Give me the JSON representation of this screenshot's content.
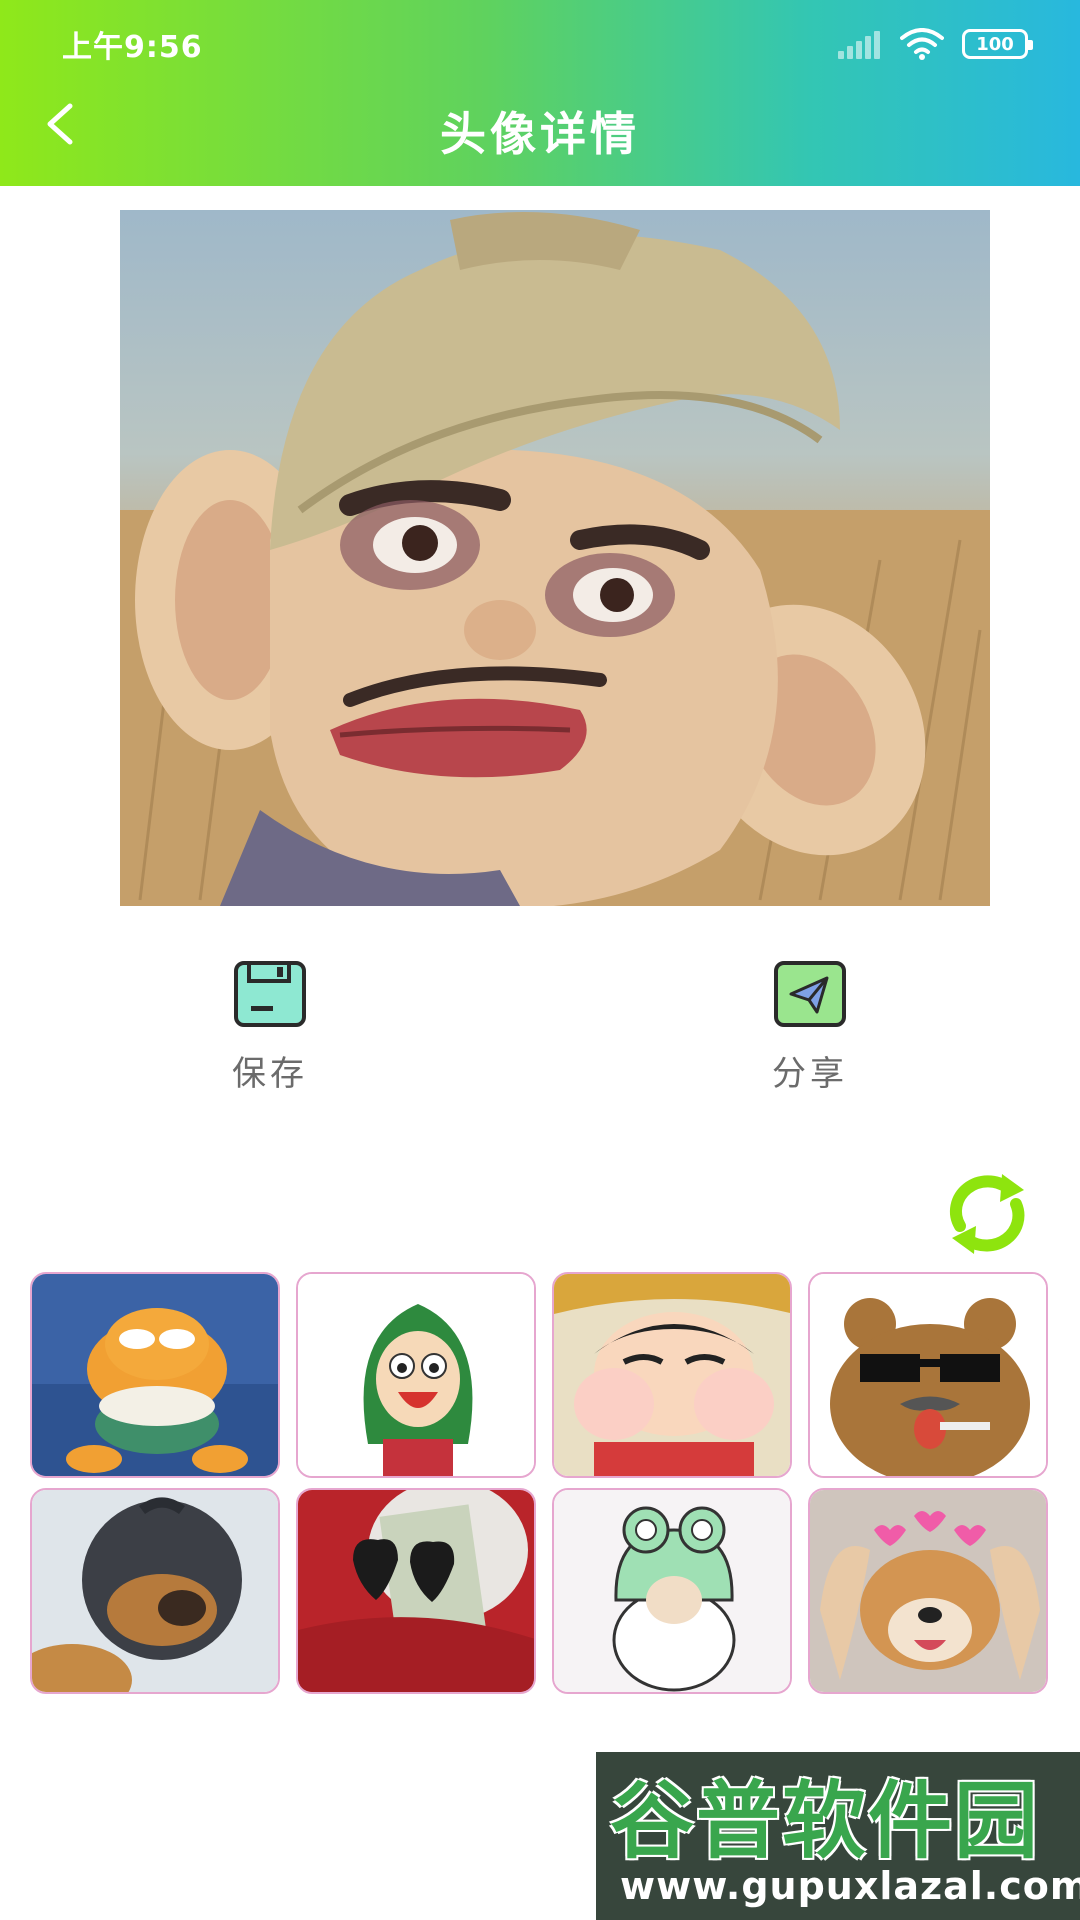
{
  "status_bar": {
    "time": "上午9:56",
    "battery": "100"
  },
  "header": {
    "title": "头像详情",
    "gradient_colors": [
      "#8fe81a",
      "#28b8de"
    ]
  },
  "actions": {
    "save_label": "保存",
    "share_label": "分享"
  },
  "colors": {
    "thumb_border": "#e6a6cf",
    "refresh_icon": "#8ee40e",
    "label_text": "#6b6b6b"
  },
  "thumbnails": [
    {
      "subject": "garfield-popcorn"
    },
    {
      "subject": "cartoon-girl-headscarf"
    },
    {
      "subject": "crayon-shin-chan"
    },
    {
      "subject": "bear-sunglasses"
    },
    {
      "subject": "dog-balaclava"
    },
    {
      "subject": "heart-sunglasses-money"
    },
    {
      "subject": "frog-hat-meme"
    },
    {
      "subject": "shiba-hearts"
    }
  ],
  "watermark": {
    "title": "谷普软件园",
    "url": "www.gupuxlazal.com"
  }
}
